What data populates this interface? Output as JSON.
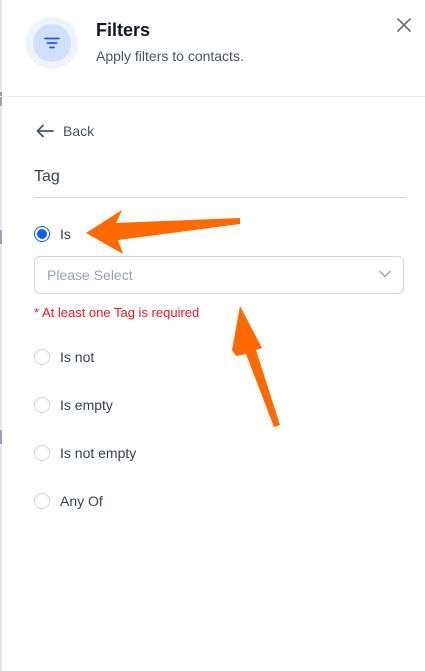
{
  "header": {
    "title": "Filters",
    "subtitle": "Apply filters to contacts.",
    "filter_icon": "filter-lines-icon",
    "close_icon": "close-icon"
  },
  "back": {
    "label": "Back",
    "icon": "arrow-left-icon"
  },
  "section": {
    "title": "Tag"
  },
  "options": [
    {
      "label": "Is",
      "checked": true
    },
    {
      "label": "Is not",
      "checked": false
    },
    {
      "label": "Is empty",
      "checked": false
    },
    {
      "label": "Is not empty",
      "checked": false
    },
    {
      "label": "Any Of",
      "checked": false
    }
  ],
  "select": {
    "placeholder": "Please Select",
    "icon": "chevron-down-icon"
  },
  "error": "* At least one Tag is required",
  "colors": {
    "accent": "#155eef",
    "error": "#e11d21",
    "annotation": "#ff6a00"
  }
}
